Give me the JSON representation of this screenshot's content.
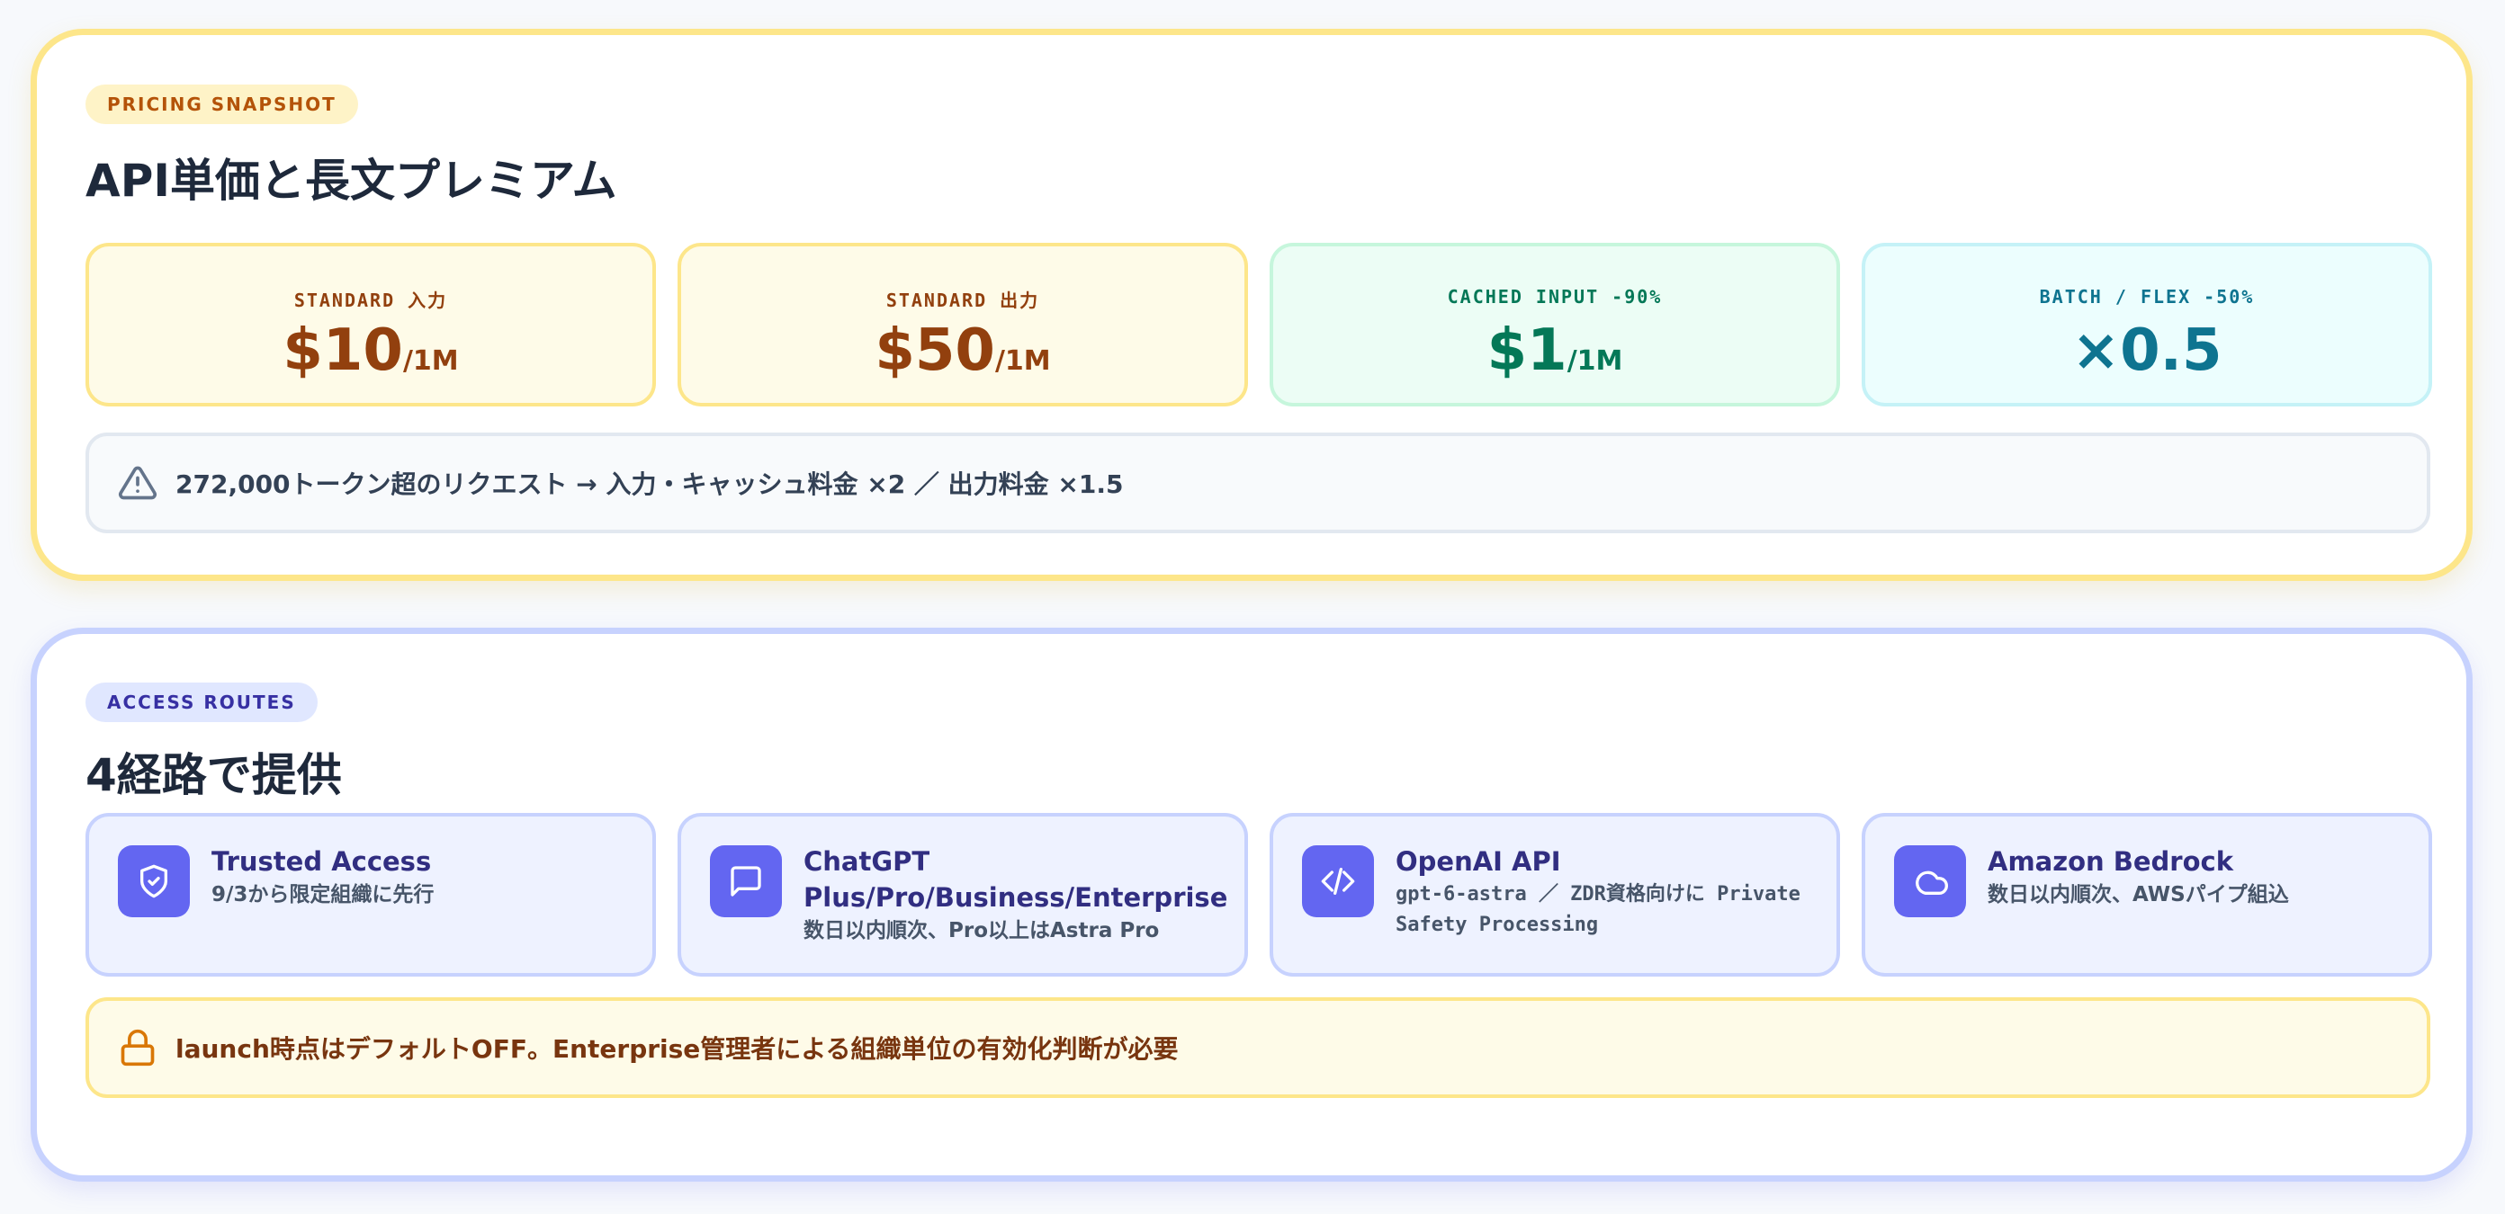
{
  "pricing": {
    "pill": "PRICING SNAPSHOT",
    "title": "API単価と長文プレミアム",
    "tiles": [
      {
        "label": "STANDARD 入力",
        "value": "$10",
        "unit": "/1M"
      },
      {
        "label": "STANDARD 出力",
        "value": "$50",
        "unit": "/1M"
      },
      {
        "label": "CACHED INPUT -90%",
        "value": "$1",
        "unit": "/1M"
      },
      {
        "label": "BATCH / FLEX -50%",
        "value": "×0.5",
        "unit": ""
      }
    ],
    "notice": "272,000トークン超のリクエスト → 入力・キャッシュ料金 ×2 ／ 出力料金 ×1.5",
    "notice_icon": "warning-triangle-icon",
    "colors": {
      "amber": "#92400e",
      "green": "#047857",
      "cyan": "#0e7490",
      "border": "#fde68a"
    }
  },
  "access": {
    "pill": "ACCESS ROUTES",
    "title": "4経路で提供",
    "routes": [
      {
        "title": "Trusted Access",
        "sub": "9/3から限定組織に先行",
        "icon": "shield-check-icon"
      },
      {
        "title": "ChatGPT Plus/Pro/Business/Enterprise",
        "sub": "数日以内順次、Pro以上はAstra Pro",
        "icon": "chat-bubble-icon"
      },
      {
        "title": "OpenAI API",
        "sub": "gpt-6-astra ／ ZDR資格向けに Private Safety Processing",
        "icon": "code-icon"
      },
      {
        "title": "Amazon Bedrock",
        "sub": "数日以内順次、AWSパイプ組込",
        "icon": "cloud-icon"
      }
    ],
    "notice": "launch時点はデフォルトOFF。Enterprise管理者による組織単位の有効化判断が必要",
    "notice_icon": "lock-icon",
    "colors": {
      "accent": "#6366f1",
      "border": "#c7d2fe",
      "title": "#312e81"
    }
  }
}
